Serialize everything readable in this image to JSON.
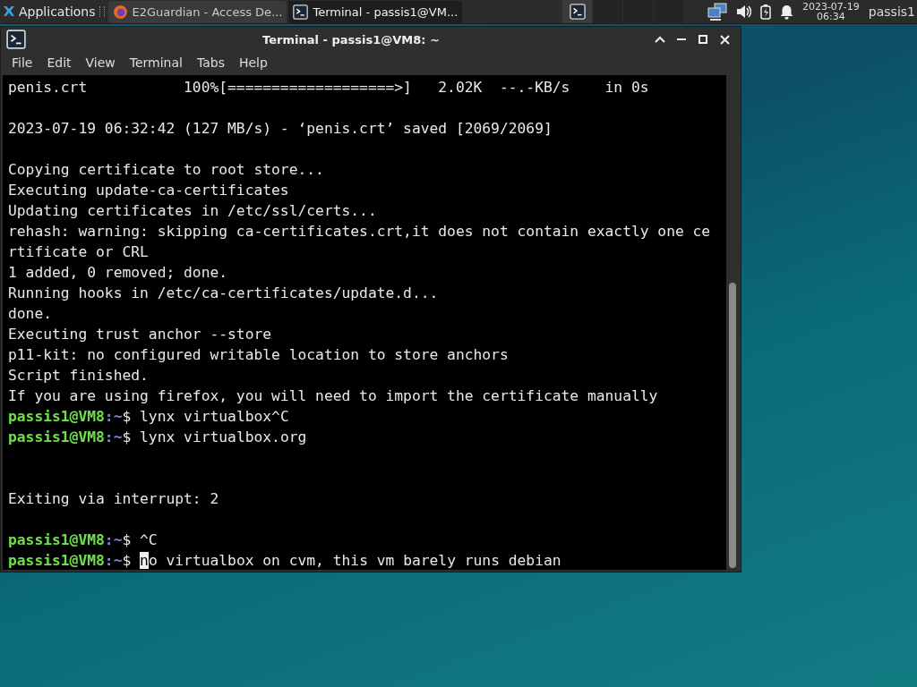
{
  "taskbar": {
    "apps_menu": {
      "label": "Applications"
    },
    "tasks": [
      {
        "title": "E2Guardian - Access De...",
        "kind": "browser",
        "selected": false
      },
      {
        "title": "Terminal - passis1@VM...",
        "kind": "terminal",
        "selected": true
      }
    ],
    "workspaces": [
      {
        "selected": true
      },
      {
        "selected": false
      },
      {
        "selected": false
      },
      {
        "selected": false
      }
    ],
    "clock": {
      "date": "2023-07-19",
      "time": "06:34"
    },
    "user": "passis1"
  },
  "window": {
    "title": "Terminal - passis1@VM8: ~",
    "menu": [
      "File",
      "Edit",
      "View",
      "Terminal",
      "Tabs",
      "Help"
    ],
    "lines": [
      {
        "kind": "output",
        "text": "penis.crt           100%[===================>]   2.02K  --.-KB/s    in 0s"
      },
      {
        "kind": "blank"
      },
      {
        "kind": "output",
        "text": "2023-07-19 06:32:42 (127 MB/s) - ‘penis.crt’ saved [2069/2069]"
      },
      {
        "kind": "blank"
      },
      {
        "kind": "output",
        "text": "Copying certificate to root store..."
      },
      {
        "kind": "output",
        "text": "Executing update-ca-certificates"
      },
      {
        "kind": "output",
        "text": "Updating certificates in /etc/ssl/certs..."
      },
      {
        "kind": "output",
        "text": "rehash: warning: skipping ca-certificates.crt,it does not contain exactly one ce"
      },
      {
        "kind": "output",
        "text": "rtificate or CRL"
      },
      {
        "kind": "output",
        "text": "1 added, 0 removed; done."
      },
      {
        "kind": "output",
        "text": "Running hooks in /etc/ca-certificates/update.d..."
      },
      {
        "kind": "output",
        "text": "done."
      },
      {
        "kind": "output",
        "text": "Executing trust anchor --store"
      },
      {
        "kind": "output",
        "text": "p11-kit: no configured writable location to store anchors"
      },
      {
        "kind": "output",
        "text": "Script finished."
      },
      {
        "kind": "output",
        "text": "If you are using firefox, you will need to import the certificate manually"
      },
      {
        "kind": "prompt",
        "user": "passis1@VM8",
        "path": ":~",
        "symbol": "$",
        "command": "lynx virtualbox^C"
      },
      {
        "kind": "prompt",
        "user": "passis1@VM8",
        "path": ":~",
        "symbol": "$",
        "command": "lynx virtualbox.org"
      },
      {
        "kind": "blank"
      },
      {
        "kind": "blank"
      },
      {
        "kind": "output",
        "text": "Exiting via interrupt: 2"
      },
      {
        "kind": "blank"
      },
      {
        "kind": "prompt",
        "user": "passis1@VM8",
        "path": ":~",
        "symbol": "$",
        "command": "^C"
      },
      {
        "kind": "prompt",
        "user": "passis1@VM8",
        "path": ":~",
        "symbol": "$",
        "cursor_char": "n",
        "command": "o virtualbox on cvm, this vm barely runs debian"
      }
    ]
  }
}
